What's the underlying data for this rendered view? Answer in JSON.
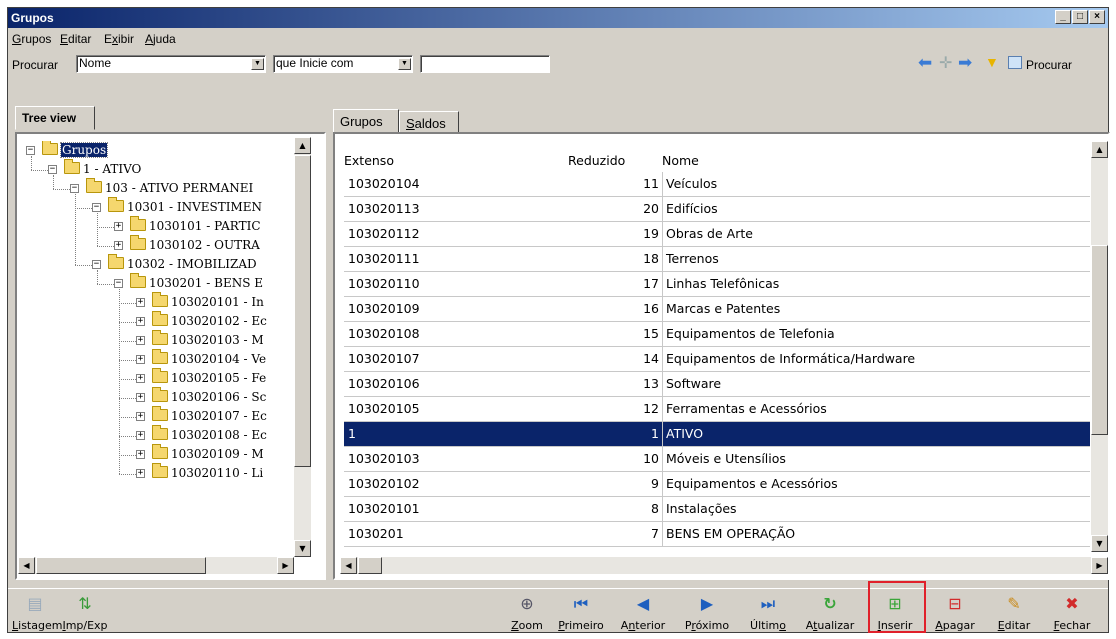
{
  "window": {
    "title": "Grupos"
  },
  "menu": [
    {
      "label": "Grupos",
      "key": "G",
      "rest": "rupos"
    },
    {
      "label": "Editar",
      "key": "E",
      "rest": "ditar"
    },
    {
      "label": "Exibir",
      "key": "x",
      "pre": "E",
      "rest": "ibir"
    },
    {
      "label": "Ajuda",
      "key": "A",
      "rest": "juda"
    }
  ],
  "search": {
    "label": "Procurar",
    "field_value": "Nome",
    "mode_value": "que Inicie com",
    "query_value": "",
    "procurar_button": "Procurar"
  },
  "left_tab": "Tree view",
  "tree": [
    {
      "label": "Grupos",
      "level": 0,
      "exp": "−",
      "selected": true
    },
    {
      "label": "1 - ATIVO",
      "level": 1,
      "exp": "−"
    },
    {
      "label": "103 - ATIVO PERMANEI",
      "level": 2,
      "exp": "−"
    },
    {
      "label": "10301 - INVESTIMEN",
      "level": 3,
      "exp": "−"
    },
    {
      "label": "1030101 - PARTIC",
      "level": 4,
      "exp": "+"
    },
    {
      "label": "1030102 - OUTRA",
      "level": 4,
      "exp": "+"
    },
    {
      "label": "10302 - IMOBILIZAD",
      "level": 3,
      "exp": "−"
    },
    {
      "label": "1030201 - BENS E",
      "level": 4,
      "exp": "−"
    },
    {
      "label": "103020101 - In",
      "level": 5,
      "exp": "+"
    },
    {
      "label": "103020102 - Ec",
      "level": 5,
      "exp": "+"
    },
    {
      "label": "103020103 - M",
      "level": 5,
      "exp": "+"
    },
    {
      "label": "103020104 - Ve",
      "level": 5,
      "exp": "+"
    },
    {
      "label": "103020105 - Fe",
      "level": 5,
      "exp": "+"
    },
    {
      "label": "103020106 - Sc",
      "level": 5,
      "exp": "+"
    },
    {
      "label": "103020107 - Ec",
      "level": 5,
      "exp": "+"
    },
    {
      "label": "103020108 - Ec",
      "level": 5,
      "exp": "+"
    },
    {
      "label": "103020109 - M",
      "level": 5,
      "exp": "+"
    },
    {
      "label": "103020110 - Li",
      "level": 5,
      "exp": "+"
    }
  ],
  "right_tabs": [
    {
      "label": "Grupos",
      "active": true
    },
    {
      "label": "Saldos",
      "active": false
    }
  ],
  "grid": {
    "headers": {
      "extenso": "Extenso",
      "reduzido": "Reduzido",
      "nome": "Nome"
    },
    "rows": [
      {
        "extenso": "103020104",
        "reduzido": "11",
        "nome": "Veículos"
      },
      {
        "extenso": "103020113",
        "reduzido": "20",
        "nome": "Edifícios"
      },
      {
        "extenso": "103020112",
        "reduzido": "19",
        "nome": "Obras de Arte"
      },
      {
        "extenso": "103020111",
        "reduzido": "18",
        "nome": "Terrenos"
      },
      {
        "extenso": "103020110",
        "reduzido": "17",
        "nome": "Linhas Telefônicas"
      },
      {
        "extenso": "103020109",
        "reduzido": "16",
        "nome": "Marcas e Patentes"
      },
      {
        "extenso": "103020108",
        "reduzido": "15",
        "nome": "Equipamentos de Telefonia"
      },
      {
        "extenso": "103020107",
        "reduzido": "14",
        "nome": "Equipamentos de Informática/Hardware"
      },
      {
        "extenso": "103020106",
        "reduzido": "13",
        "nome": "Software"
      },
      {
        "extenso": "103020105",
        "reduzido": "12",
        "nome": "Ferramentas e Acessórios"
      },
      {
        "extenso": "1",
        "reduzido": "1",
        "nome": "ATIVO",
        "selected": true
      },
      {
        "extenso": "103020103",
        "reduzido": "10",
        "nome": "Móveis e Utensílios"
      },
      {
        "extenso": "103020102",
        "reduzido": "9",
        "nome": "Equipamentos e Acessórios"
      },
      {
        "extenso": "103020101",
        "reduzido": "8",
        "nome": "Instalações"
      },
      {
        "extenso": "1030201",
        "reduzido": "7",
        "nome": "BENS EM OPERAÇÃO"
      }
    ]
  },
  "toolbar": {
    "listagem": "Listagem",
    "impexp": "Imp/Exp",
    "zoom": "Zoom",
    "primeiro": "Primeiro",
    "anterior": "Anterior",
    "proximo": "Próximo",
    "ultimo": "Último",
    "atualizar": "Atualizar",
    "inserir": "Inserir",
    "apagar": "Apagar",
    "editar": "Editar",
    "fechar": "Fechar"
  },
  "colors": {
    "selection": "#0a246a",
    "highlight": "#e0202a",
    "nav_blue": "#1e5fbf",
    "refresh_green": "#3aa53a",
    "close_red": "#d22b2b"
  }
}
